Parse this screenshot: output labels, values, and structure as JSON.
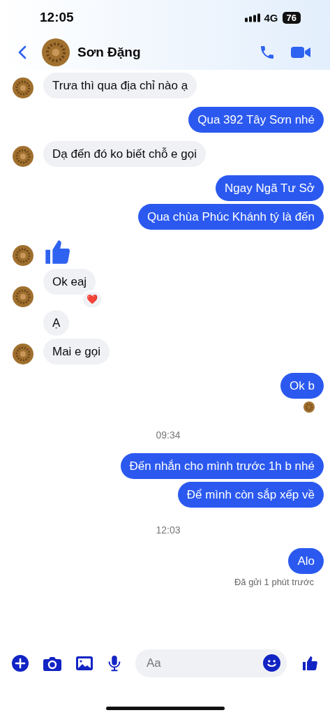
{
  "status_bar": {
    "time": "12:05",
    "network": "4G",
    "battery": "76"
  },
  "header": {
    "name": "Sơn Đặng"
  },
  "messages": [
    {
      "kind": "incoming",
      "text": "Trưa thì qua địa chỉ nào ạ",
      "avatar": true
    },
    {
      "kind": "outgoing",
      "text": "Qua 392 Tây Sơn nhé"
    },
    {
      "kind": "incoming",
      "text": "Dạ đến đó ko biết chỗ e gọi",
      "avatar": true
    },
    {
      "kind": "outgoing",
      "text": "Ngay Ngã Tư Sở"
    },
    {
      "kind": "outgoing",
      "text": "Qua chùa Phúc Khánh tý là đến"
    },
    {
      "kind": "like",
      "avatar": true
    },
    {
      "kind": "incoming",
      "text": "Ok eaj",
      "avatar": true,
      "reaction": "❤️"
    },
    {
      "kind": "incoming",
      "text": "Ạ",
      "avatar": false
    },
    {
      "kind": "incoming",
      "text": "Mai e gọi",
      "avatar": true
    },
    {
      "kind": "outgoing",
      "text": "Ok b"
    },
    {
      "kind": "seen"
    },
    {
      "kind": "time",
      "text": "09:34"
    },
    {
      "kind": "outgoing",
      "text": "Đến nhắn cho mình trước 1h b nhé"
    },
    {
      "kind": "outgoing",
      "text": "Để mình còn sắp xếp về"
    },
    {
      "kind": "time",
      "text": "12:03"
    },
    {
      "kind": "outgoing",
      "text": "Alo"
    },
    {
      "kind": "status",
      "text": "Đã gửi 1 phút trước"
    }
  ],
  "composer": {
    "placeholder": "Aa"
  }
}
